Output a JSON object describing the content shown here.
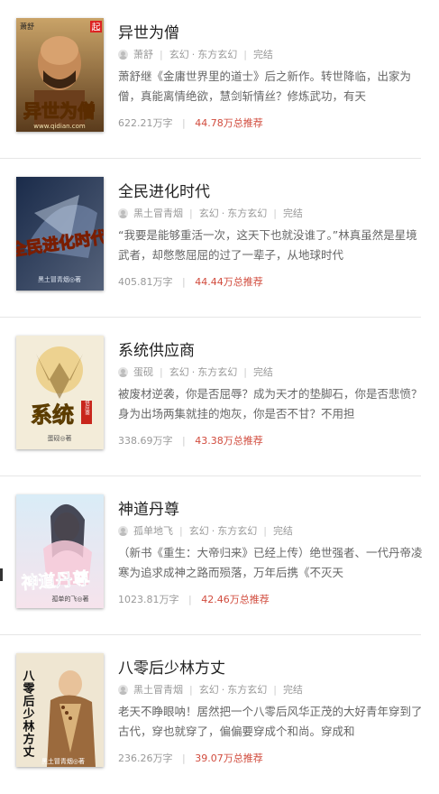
{
  "books": [
    {
      "title": "异世为僧",
      "author": "萧舒",
      "category": "玄幻",
      "subcategory": "东方玄幻",
      "status": "完结",
      "description": "萧舒继《金庸世界里的道士》后之新作。转世降临，出家为僧，真能离情绝欲，慧剑斩情丝？修炼武功，有天",
      "words": "622.21万字",
      "recommend": "44.78万总推荐",
      "cover_text": "异世为僧",
      "cover_url": "www.qidian.com",
      "cover_author": "萧舒",
      "cover_badge": "起"
    },
    {
      "title": "全民进化时代",
      "author": "黑土冒青烟",
      "category": "玄幻",
      "subcategory": "东方玄幻",
      "status": "完结",
      "description": "“我要是能够重活一次，这天下也就没谁了。”林真虽然是星境武者，却憋憋屈屈的过了一辈子，从地球时代",
      "words": "405.81万字",
      "recommend": "44.44万总推荐",
      "cover_text": "全民进化时代",
      "cover_author": "黑土冒青烟◎著"
    },
    {
      "title": "系统供应商",
      "author": "蛋砚",
      "category": "玄幻",
      "subcategory": "东方玄幻",
      "status": "完结",
      "description": "被废材逆袭，你是否屈辱？成为天才的垫脚石，你是否悲愤？身为出场两集就挂的炮灰，你是否不甘？不用担",
      "words": "338.69万字",
      "recommend": "43.38万总推荐",
      "cover_text": "系统",
      "cover_sub": "供应商",
      "cover_author": "蛋砚◎著"
    },
    {
      "title": "神道丹尊",
      "author": "孤单地飞",
      "category": "玄幻",
      "subcategory": "东方玄幻",
      "status": "完结",
      "description": "（新书《重生：大帝归来》已经上传）绝世强者、一代丹帝凌寒为追求成神之路而殒落，万年后携《不灭天",
      "words": "1023.81万字",
      "recommend": "42.46万总推荐",
      "cover_text": "神道丹尊",
      "cover_author": "孤单的飞◎著"
    },
    {
      "title": "八零后少林方丈",
      "author": "黑土冒青烟",
      "category": "玄幻",
      "subcategory": "东方玄幻",
      "status": "完结",
      "description": "老天不睁眼呐！居然把一个八零后风华正茂的大好青年穿到了古代，穿也就穿了，偏偏要穿成个和尚。穿成和",
      "words": "236.26万字",
      "recommend": "39.07万总推荐",
      "cover_text": "八零后少林方丈",
      "cover_author": "黑土冒青烟◎著"
    }
  ],
  "colors": {
    "title": "#222222",
    "meta": "#999999",
    "recommend": "#d14b3d",
    "separator": "#e6e6e6"
  }
}
